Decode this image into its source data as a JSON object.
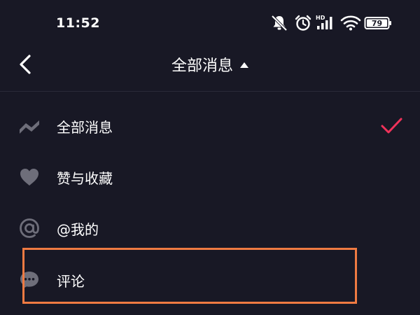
{
  "status": {
    "time": "11:52",
    "battery": "79",
    "hd_badge": "HD",
    "icons": [
      "bell-muted-icon",
      "alarm-icon",
      "signal-icon",
      "wifi-icon",
      "battery-icon"
    ]
  },
  "nav": {
    "title": "全部消息",
    "back_icon": "chevron-left-icon",
    "caret_icon": "caret-up-icon"
  },
  "menu": {
    "items": [
      {
        "label": "全部消息",
        "icon": "wave-icon",
        "selected": true
      },
      {
        "label": "赞与收藏",
        "icon": "heart-icon",
        "selected": false
      },
      {
        "label": "@我的",
        "icon": "at-icon",
        "selected": false
      },
      {
        "label": "评论",
        "icon": "comment-icon",
        "selected": false
      }
    ]
  },
  "colors": {
    "background": "#181825",
    "text": "#ffffff",
    "icon": "#6e6e7a",
    "check": "#f0325a",
    "highlight": "#ef7a42"
  }
}
